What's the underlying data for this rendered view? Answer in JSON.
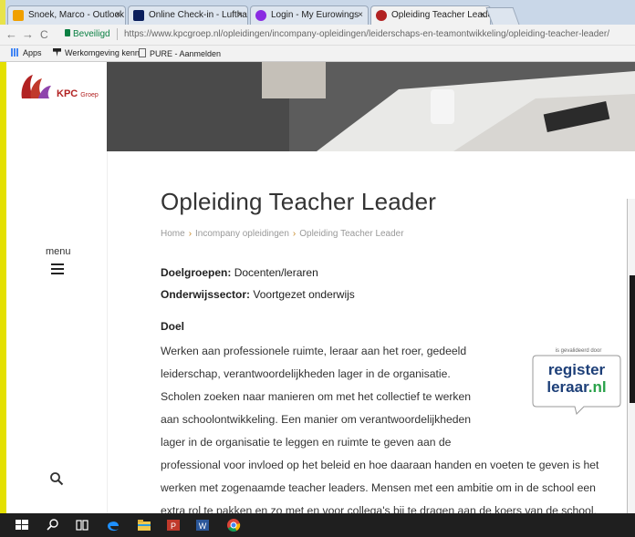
{
  "browser": {
    "tabs": [
      {
        "label": "Snoek, Marco - Outlook",
        "favicon_color": "#f0a000",
        "active": false
      },
      {
        "label": "Online Check-in - Lufthan",
        "favicon_color": "#0a1e5c",
        "active": false
      },
      {
        "label": "Login - My Eurowings",
        "favicon_color": "#8a2be2",
        "active": false
      },
      {
        "label": "Opleiding Teacher Leade",
        "favicon_color": "#b22222",
        "active": true
      }
    ],
    "secure_label": "Beveiligd",
    "url": "https://www.kpcgroep.nl/opleidingen/incompany-opleidingen/leiderschaps-en-teamontwikkeling/opleiding-teacher-leader/",
    "bookmarks": [
      {
        "label": "Apps",
        "icon": "apps-grid-icon"
      },
      {
        "label": "Werkomgeving kenn",
        "icon": "bookmark-icon"
      },
      {
        "label": "PURE - Aanmelden",
        "icon": "page-icon"
      }
    ]
  },
  "site": {
    "logo_text": "KPC",
    "logo_sub": "Groep",
    "menu_label": "menu"
  },
  "page": {
    "title": "Opleiding Teacher Leader",
    "breadcrumb": [
      "Home",
      "Incompany opleidingen",
      "Opleiding Teacher Leader"
    ],
    "doelgroepen_label": "Doelgroepen:",
    "doelgroepen_value": "Docenten/leraren",
    "sector_label": "Onderwijssector:",
    "sector_value": "Voortgezet onderwijs",
    "doel_heading": "Doel",
    "paragraph_lines": [
      "Werken aan professionele ruimte, leraar aan het roer, gedeeld",
      "leiderschap, verantwoordelijkheden lager in de organisatie.",
      "Scholen zoeken naar manieren om met het collectief te werken",
      "aan schoolontwikkeling. Een manier om verantwoordelijkheden",
      "lager in de organisatie te leggen en ruimte te geven aan de",
      "professional voor invloed op het beleid en hoe daaraan handen en voeten te geven is het",
      "werken met zogenaamde teacher leaders. Mensen met een ambitie om in de school een",
      "extra rol te pakken en zo met en voor collega's bij te dragen aan de koers van de school."
    ],
    "badge": {
      "caption": "is gevalideerd door",
      "line1": "register",
      "line2_a": "leraar",
      "line2_b": ".nl"
    }
  },
  "colors": {
    "accent_yellow": "#e4e000",
    "brand_red": "#b22222",
    "badge_blue": "#1d3f78",
    "badge_green": "#2aa24a"
  }
}
